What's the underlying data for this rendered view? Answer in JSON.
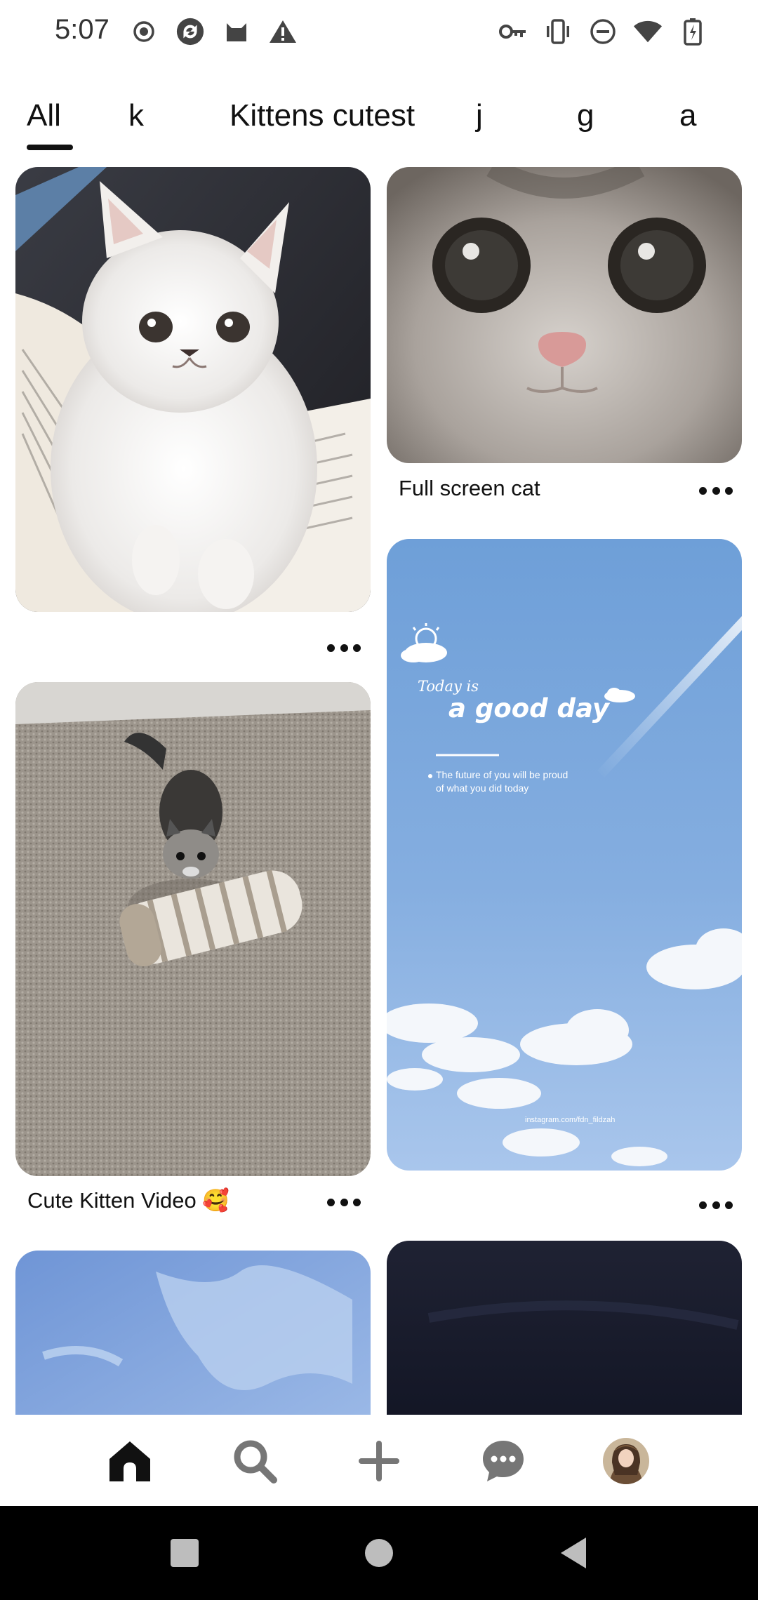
{
  "status_bar": {
    "time": "5:07",
    "left_icons": [
      "record-icon",
      "sync-icon",
      "cat-notification-icon",
      "warning-icon"
    ],
    "right_icons": [
      "vpn-key-icon",
      "vibrate-icon",
      "do-not-disturb-icon",
      "wifi-icon",
      "battery-charging-icon"
    ]
  },
  "tabs": [
    {
      "label": "All",
      "active": true
    },
    {
      "label": "k",
      "active": false
    },
    {
      "label": "Kittens cutest",
      "active": false
    },
    {
      "label": "j",
      "active": false
    },
    {
      "label": "g",
      "active": false
    },
    {
      "label": "a",
      "active": false
    }
  ],
  "pins": [
    {
      "title": "",
      "image": "white fluffy kitten on an open book"
    },
    {
      "title": "Full screen cat",
      "image": "close-up of grey and white kitten face"
    },
    {
      "title": "",
      "image": "blue sky wallpaper",
      "overlay": {
        "heading_small": "Today is",
        "heading_big": "a good day",
        "quote_line_1": "The future of you will be proud",
        "quote_line_2": "of what you did today",
        "credit": "instagram.com/fdn_fildzah"
      }
    },
    {
      "title": "Cute Kitten Video 🥰",
      "image": "tiny kitten walking on a striped sock on carpet"
    },
    {
      "title": "",
      "image": "blue watercolor texture"
    },
    {
      "title": "",
      "image": "dark navy texture"
    }
  ],
  "bottom_nav": [
    {
      "name": "home",
      "active": true
    },
    {
      "name": "search",
      "active": false
    },
    {
      "name": "create",
      "active": false
    },
    {
      "name": "messages",
      "active": false
    },
    {
      "name": "profile",
      "active": false
    }
  ],
  "colors": {
    "text": "#111111",
    "nav_icon": "#767676",
    "sky": "#8db4e2",
    "system_bar": "#000000"
  }
}
